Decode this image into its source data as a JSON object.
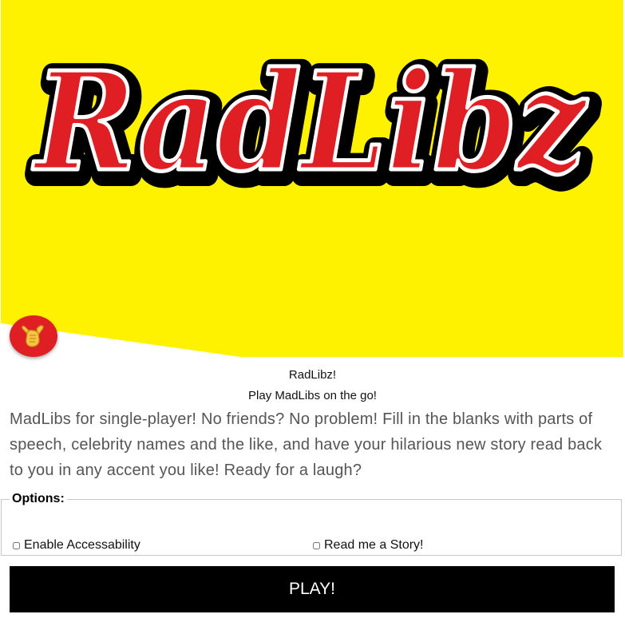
{
  "header": {
    "logo_text": "RadLibz",
    "badge_icon": "shaka-hand-icon",
    "colors": {
      "background": "#fff200",
      "logo_red": "#e01f24",
      "logo_outline": "#000000"
    }
  },
  "intro": {
    "title": "RadLibz!",
    "subtitle": "Play MadLibs on the go!",
    "description": "MadLibs for single-player! No friends? No problem! Fill in the blanks with parts of speech, celebrity names and the like, and have your hilarious new story read back to you in any accent you like! Ready for a laugh?"
  },
  "options": {
    "legend": "Options:",
    "accessibility_label": "Enable Accessability",
    "story_label": "Read me a Story!"
  },
  "actions": {
    "play_label": "PLAY!"
  }
}
